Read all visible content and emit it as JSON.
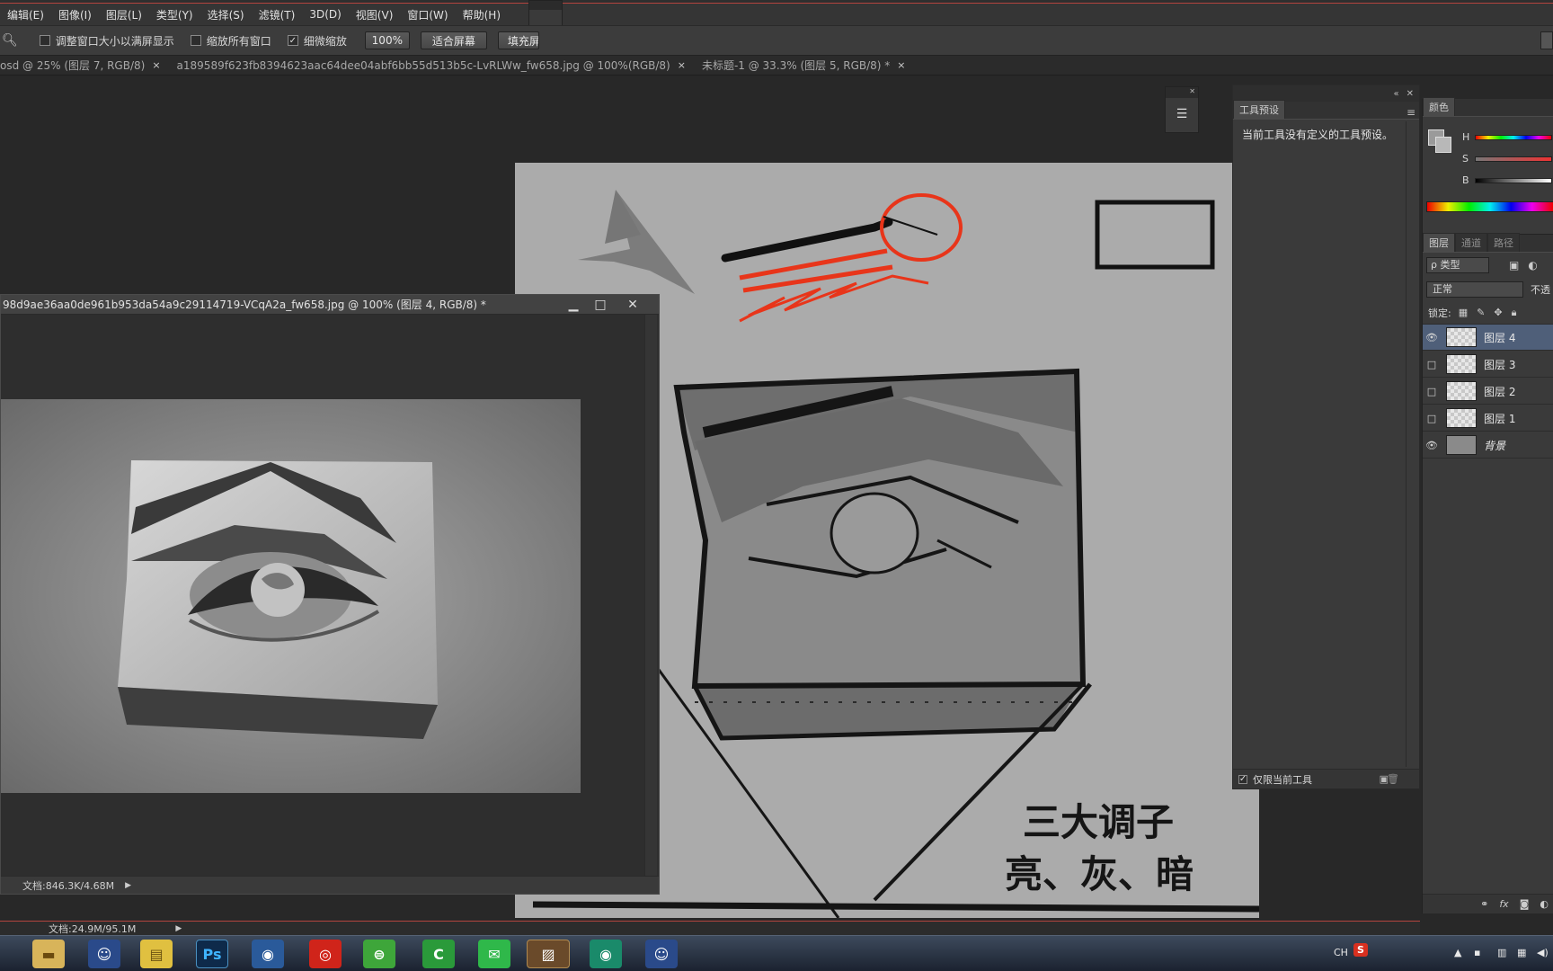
{
  "menu": [
    "编辑(E)",
    "图像(I)",
    "图层(L)",
    "类型(Y)",
    "选择(S)",
    "滤镜(T)",
    "3D(D)",
    "视图(V)",
    "窗口(W)",
    "帮助(H)"
  ],
  "options": {
    "fit_window": "调整窗口大小以满屏显示",
    "zoom_all": "缩放所有窗口",
    "scrubby_zoom": "细微缩放",
    "scrubby_checked": "✓",
    "zoom_value": "100%",
    "fit_screen": "适合屏幕",
    "fill_screen": "填充屏"
  },
  "tabs": [
    {
      "label": "osd @ 25% (图层 7, RGB/8)",
      "close": "×"
    },
    {
      "label": "a189589f623fb8394623aac64dee04abf6bb55d513b5c-LvRLWw_fw658.jpg @ 100%(RGB/8)",
      "close": "×"
    },
    {
      "label": "未标题-1 @ 33.3% (图层 5, RGB/8) *",
      "close": "×"
    }
  ],
  "doc_window": {
    "title": "98d9ae36aa0de961b953da54a9c29114719-VCqA2a_fw658.jpg @ 100% (图层 4, RGB/8) *",
    "status": "文档:846.3K/4.68M",
    "minimize": "▁",
    "maximize": "□",
    "close": "✕"
  },
  "main_status": "文档:24.9M/95.1M",
  "canvas_text": {
    "line1": "三大调子",
    "line2": "亮、灰、暗"
  },
  "tool_preset": {
    "tab": "工具预设",
    "message": "当前工具没有定义的工具预设。",
    "current_only": "仅限当前工具",
    "current_only_checked": "✓"
  },
  "color_panel": {
    "tab": "颜色",
    "h": "H",
    "s": "S",
    "b": "B"
  },
  "layers_panel": {
    "tabs": [
      "图层",
      "通道",
      "路径"
    ],
    "kind": "ρ 类型",
    "blend": "正常",
    "opacity": "不透",
    "lock": "锁定:",
    "layers": [
      {
        "name": "图层 4",
        "visible": true,
        "selected": true
      },
      {
        "name": "图层 3",
        "visible": false,
        "selected": false
      },
      {
        "name": "图层 2",
        "visible": false,
        "selected": false
      },
      {
        "name": "图层 1",
        "visible": false,
        "selected": false
      },
      {
        "name": "背景",
        "visible": true,
        "selected": false
      }
    ],
    "footer": "fx"
  },
  "taskbar": {
    "apps": [
      "folder",
      "qq-penguin",
      "notepad",
      "Ps",
      "browser",
      "netease-music",
      "360-browser",
      "camtasia",
      "wechat",
      "photo",
      "iqiyi",
      "qq-penguin-2"
    ],
    "ime": "CH",
    "sogou": "S"
  },
  "colors": {
    "accent_red": "#b3443e",
    "selected_layer": "#4f5f79",
    "stroke_red": "#e8351a"
  }
}
